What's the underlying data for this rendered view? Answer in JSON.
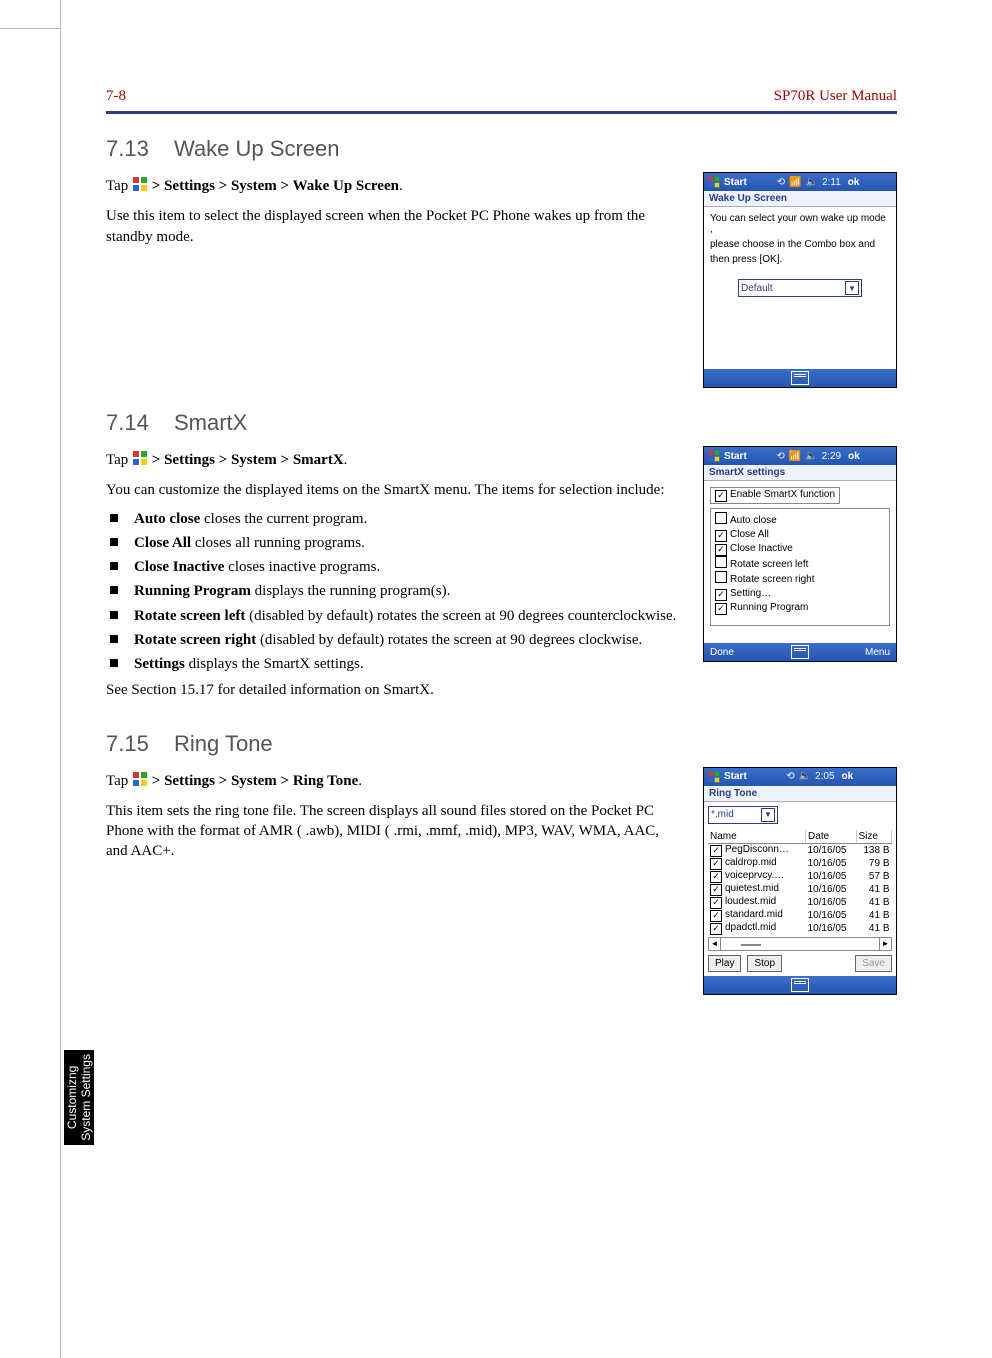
{
  "header": {
    "page_num": "7-8",
    "manual_title": "SP70R User Manual"
  },
  "side_tab": {
    "line1": "Customizng",
    "line2": "System Settings"
  },
  "sec713": {
    "num": "7.13",
    "title": "Wake Up Screen",
    "tap_prefix": "Tap ",
    "tap_path": " > Settings > System > Wake Up Screen",
    "dot": ".",
    "para": "Use this item to select the displayed screen when the Pocket PC Phone wakes up from the standby mode.",
    "shot": {
      "start": "Start",
      "time": "2:11",
      "ok": "ok",
      "subtitle": "Wake Up Screen",
      "body1": "You can select your own wake up mode ,",
      "body2": "please choose in the Combo box and",
      "body3": "then press [OK].",
      "combo_value": "Default"
    }
  },
  "sec714": {
    "num": "7.14",
    "title": "SmartX",
    "tap_prefix": "Tap ",
    "tap_path": " > Settings > System > SmartX",
    "dot": ".",
    "para": "You can customize the displayed items on the SmartX menu. The items for selection include:",
    "items": [
      {
        "b": "Auto close",
        "t": "  closes the current program."
      },
      {
        "b": "Close All",
        "t": "  closes all running programs."
      },
      {
        "b": "Close Inactive",
        "t": "  closes inactive programs."
      },
      {
        "b": "Running Program",
        "t": "  displays the running program(s)."
      },
      {
        "b": "Rotate screen left",
        "t": "  (disabled by default) rotates the screen at 90 degrees counterclockwise."
      },
      {
        "b": "Rotate screen right",
        "t": "  (disabled by default) rotates the screen at 90 degrees clockwise."
      },
      {
        "b": "Settings",
        "t": "  displays the SmartX settings."
      }
    ],
    "after": "See Section 15.17 for detailed information on SmartX.",
    "shot": {
      "start": "Start",
      "time": "2:29",
      "ok": "ok",
      "subtitle": "SmartX settings",
      "enable": "Enable SmartX function",
      "opts": [
        {
          "c": false,
          "l": "Auto close"
        },
        {
          "c": true,
          "l": "Close All"
        },
        {
          "c": true,
          "l": "Close Inactive"
        },
        {
          "c": false,
          "l": "Rotate screen left"
        },
        {
          "c": false,
          "l": "Rotate screen right"
        },
        {
          "c": true,
          "l": "Setting…"
        },
        {
          "c": true,
          "l": "Running Program"
        }
      ],
      "done": "Done",
      "menu": "Menu"
    }
  },
  "sec715": {
    "num": "7.15",
    "title": "Ring Tone",
    "tap_prefix": "Tap ",
    "tap_path": " > Settings > System > Ring Tone",
    "dot": ".",
    "para": "This item sets the ring tone file. The screen displays all sound files stored on the Pocket PC Phone with the format of AMR ( .awb), MIDI ( .rmi, .mmf, .mid), MP3, WAV, WMA, AAC, and AAC+.",
    "shot": {
      "start": "Start",
      "time": "2:05",
      "ok": "ok",
      "subtitle": "Ring Tone",
      "filter": "*.mid",
      "cols": {
        "name": "Name",
        "date": "Date",
        "size": "Size"
      },
      "rows": [
        {
          "c": true,
          "n": "PegDisconn…",
          "d": "10/16/05",
          "s": "138 B"
        },
        {
          "c": true,
          "n": "caldrop.mid",
          "d": "10/16/05",
          "s": "79 B"
        },
        {
          "c": true,
          "n": "voiceprvcy.…",
          "d": "10/16/05",
          "s": "57 B"
        },
        {
          "c": true,
          "n": "quietest.mid",
          "d": "10/16/05",
          "s": "41 B"
        },
        {
          "c": true,
          "n": "loudest.mid",
          "d": "10/16/05",
          "s": "41 B"
        },
        {
          "c": true,
          "n": "standard.mid",
          "d": "10/16/05",
          "s": "41 B"
        },
        {
          "c": true,
          "n": "dpadctl.mid",
          "d": "10/16/05",
          "s": "41 B"
        }
      ],
      "play": "Play",
      "stop": "Stop",
      "save": "Save"
    }
  }
}
